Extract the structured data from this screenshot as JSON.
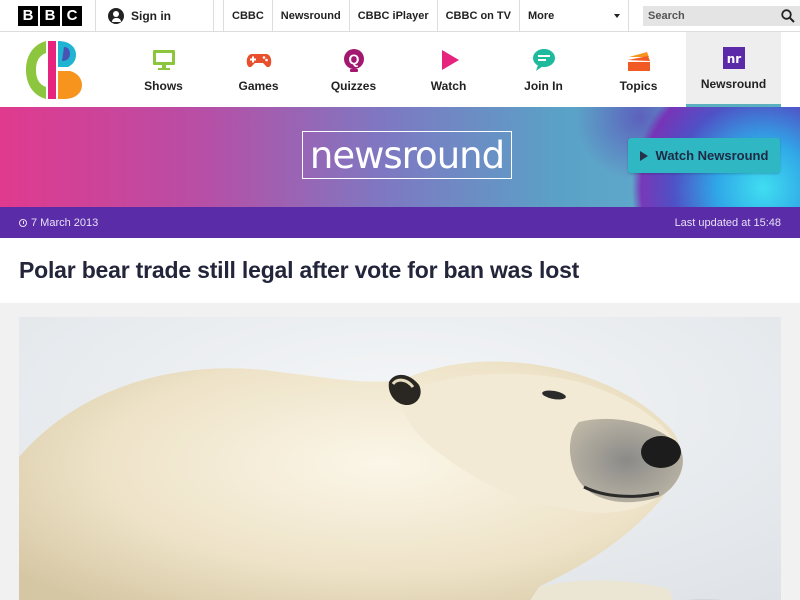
{
  "bbc_bar": {
    "logo_letters": [
      "B",
      "B",
      "C"
    ],
    "signin_label": "Sign in",
    "links": [
      "CBBC",
      "Newsround",
      "CBBC iPlayer",
      "CBBC on TV"
    ],
    "more_label": "More",
    "search_placeholder": "Search"
  },
  "cbbc_nav": {
    "items": [
      {
        "label": "Shows",
        "icon": "tv-icon",
        "color": "#8cc63f"
      },
      {
        "label": "Games",
        "icon": "gamepad-icon",
        "color": "#e8502d"
      },
      {
        "label": "Quizzes",
        "icon": "quiz-icon",
        "color": "#a2186e"
      },
      {
        "label": "Watch",
        "icon": "play-icon",
        "color": "#e6237d"
      },
      {
        "label": "Join In",
        "icon": "chat-icon",
        "color": "#1fb99e"
      },
      {
        "label": "Topics",
        "icon": "folders-icon",
        "color": "#f15a24"
      },
      {
        "label": "Newsround",
        "icon": "newsround-icon",
        "color": "#5b2aa8"
      }
    ],
    "active": "Newsround"
  },
  "banner": {
    "wordmark": "newsround",
    "watch_label": "Watch Newsround"
  },
  "datebar": {
    "date": "7 March 2013",
    "last_updated": "Last updated at 15:48"
  },
  "article": {
    "headline": "Polar bear trade still legal after vote for ban was lost"
  }
}
